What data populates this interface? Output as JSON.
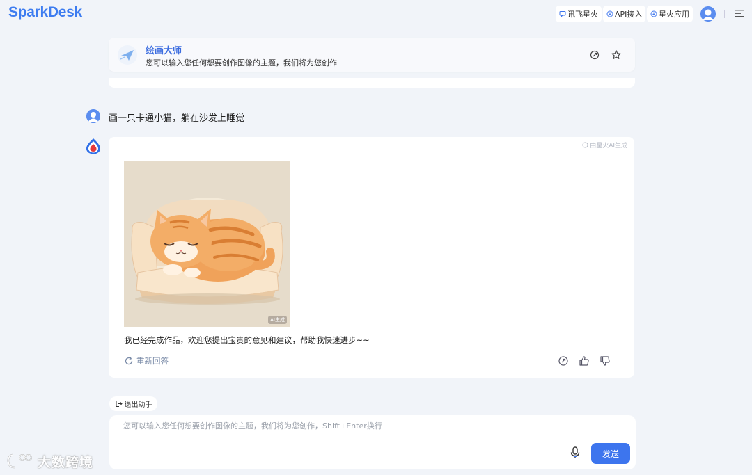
{
  "header": {
    "logo": "SparkDesk",
    "links": [
      "讯飞星火",
      "API接入",
      "星火应用"
    ]
  },
  "assistant": {
    "title": "绘画大师",
    "description": "您可以输入您任何想要创作图像的主题，我们将为您创作"
  },
  "user_message": "画一只卡通小猫，躺在沙发上睡觉",
  "bot_message": {
    "ai_tag": "由星火AI生成",
    "image_badge": "AI生成",
    "text": "我已经完成作品，欢迎您提出宝贵的意见和建议，帮助我快速进步~~",
    "regenerate": "重新回答"
  },
  "exit_label": "退出助手",
  "input": {
    "placeholder": "您可以输入您任何想要创作图像的主题，我们将为您创作，Shift+Enter换行",
    "value": "",
    "send": "发送"
  },
  "watermark": "大数跨境",
  "colors": {
    "accent": "#3d75ee",
    "background": "#f1f4f9"
  }
}
